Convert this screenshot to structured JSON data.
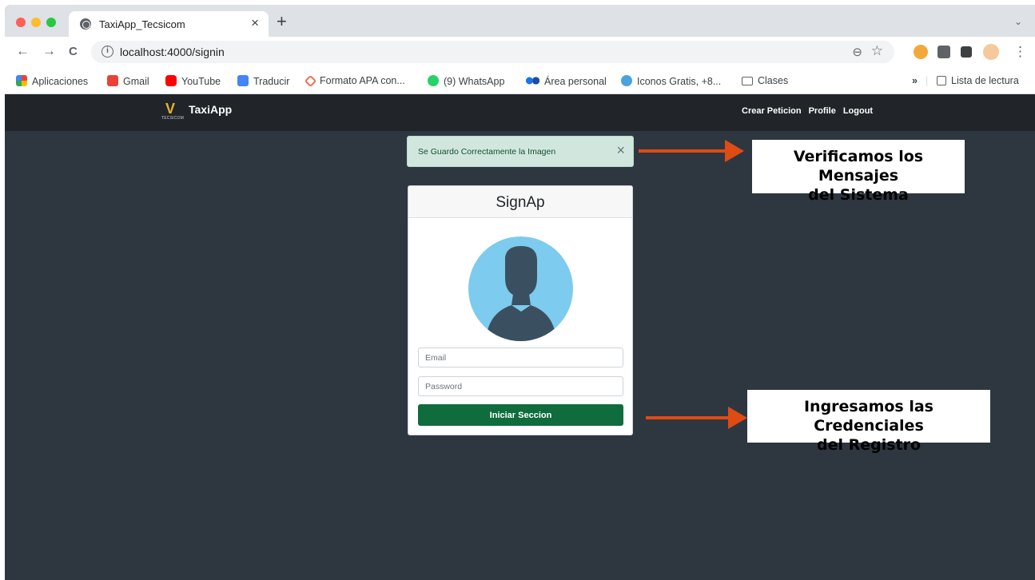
{
  "browser": {
    "tab_title": "TaxiApp_Tecsicom",
    "tab_close": "×",
    "new_tab": "+",
    "tab_menu": "⌄",
    "url": "localhost:4000/signin",
    "info_icon": "i",
    "zoom_icon": "⊖",
    "star_icon": "☆",
    "back": "←",
    "forward": "→",
    "reload": "C",
    "menu": "⋮",
    "bookmarks": [
      {
        "label": "Aplicaciones",
        "icon": "apps-grid-icon",
        "color": "#ea4335"
      },
      {
        "label": "Gmail",
        "icon": "gmail-icon",
        "color": "#ea4335"
      },
      {
        "label": "YouTube",
        "icon": "youtube-icon",
        "color": "#ff0000"
      },
      {
        "label": "Traducir",
        "icon": "translate-icon",
        "color": "#4285f4"
      },
      {
        "label": "Formato APA con...",
        "icon": "apa-icon",
        "color": "#f26c4f"
      },
      {
        "label": "(9) WhatsApp",
        "icon": "whatsapp-icon",
        "color": "#25d366"
      },
      {
        "label": "Área personal",
        "icon": "moodle-icon",
        "color": "#1a73e8"
      },
      {
        "label": "Iconos Gratis, +8...",
        "icon": "flaticon-icon",
        "color": "#4aa3df"
      },
      {
        "label": "Clases",
        "icon": "folder-icon",
        "color": "#5f6368"
      }
    ],
    "bookmarks_overflow": "»",
    "reading_list": "Lista de lectura"
  },
  "navbar": {
    "brand": "TaxiApp",
    "logo_small": "TECSICOM",
    "links": [
      "Crear Peticion",
      "Profile",
      "Logout"
    ]
  },
  "alert": {
    "message": "Se Guardo Correctamente la Imagen",
    "close": "×",
    "color": "#d1e7dd"
  },
  "signin": {
    "title": "SignAp",
    "email_placeholder": "Email",
    "password_placeholder": "Password",
    "submit_label": "Iniciar Seccion",
    "button_color": "#0f6c3d"
  },
  "annotations": [
    {
      "line1": "Verificamos los Mensajes",
      "line2": "del Sistema"
    },
    {
      "line1": "Ingresamos las Credenciales",
      "line2": "del Registro"
    }
  ],
  "colors": {
    "page_bg": "#2e3740",
    "navbar_bg": "#212529",
    "arrow": "#e04b14"
  }
}
